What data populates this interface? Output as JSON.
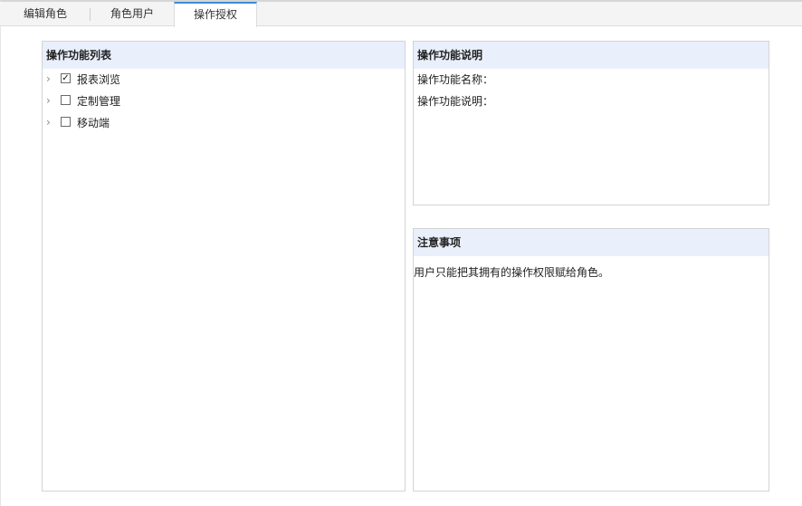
{
  "tabs": [
    {
      "label": "编辑角色"
    },
    {
      "label": "角色用户"
    },
    {
      "label": "操作授权"
    }
  ],
  "function_list": {
    "title": "操作功能列表",
    "items": [
      {
        "label": "报表浏览",
        "checked": true
      },
      {
        "label": "定制管理",
        "checked": false
      },
      {
        "label": "移动端",
        "checked": false
      }
    ]
  },
  "function_desc": {
    "title": "操作功能说明",
    "name_label": "操作功能名称：",
    "desc_label": "操作功能说明："
  },
  "notice": {
    "title": "注意事项",
    "text": "用户只能把其拥有的操作权限赋给角色。"
  },
  "colors": {
    "active_tab_border": "#3c8ad8",
    "panel_header_bg": "#e9effb"
  },
  "icons": {
    "expand": "chevron-right-icon",
    "checked": "checkbox-checked-icon",
    "unchecked": "checkbox-unchecked-icon"
  }
}
